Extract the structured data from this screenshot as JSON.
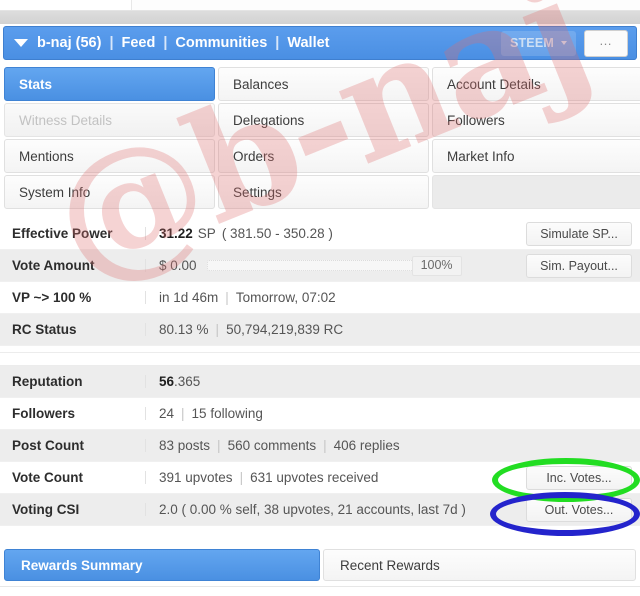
{
  "header": {
    "caret_icon": "chevron-down-icon",
    "account": "b-naj (56)",
    "links": [
      "Feed",
      "Communities",
      "Wallet"
    ],
    "separator": "|",
    "chain_selector": "STEEM",
    "more_button": "…"
  },
  "tabs": [
    {
      "label": "Stats",
      "state": "active"
    },
    {
      "label": "Balances",
      "state": "normal"
    },
    {
      "label": "Account Details",
      "state": "normal"
    },
    {
      "label": "Witness Details",
      "state": "disabled"
    },
    {
      "label": "Delegations",
      "state": "normal"
    },
    {
      "label": "Followers",
      "state": "normal"
    },
    {
      "label": "Mentions",
      "state": "normal"
    },
    {
      "label": "Orders",
      "state": "normal"
    },
    {
      "label": "Market Info",
      "state": "normal"
    },
    {
      "label": "System Info",
      "state": "normal"
    },
    {
      "label": "Settings",
      "state": "normal"
    },
    {
      "label": "",
      "state": "empty"
    }
  ],
  "stats_group_1": [
    {
      "label": "Effective Power",
      "value_main": "31.22",
      "value_unit": "SP",
      "value_detail": "( 381.50 - 350.28 )",
      "action": "Simulate SP..."
    },
    {
      "label": "Vote Amount",
      "value_main": "$ 0.00",
      "bar_percent": "100%",
      "action": "Sim. Payout..."
    },
    {
      "label": "VP ~> 100 %",
      "value_main": "in 1d 46m",
      "value_detail": "Tomorrow, 07:02"
    },
    {
      "label": "RC Status",
      "value_main": "80.13 %",
      "value_detail": "50,794,219,839 RC"
    }
  ],
  "stats_group_2": [
    {
      "label": "Reputation",
      "value_main": "56",
      "value_detail": ".365"
    },
    {
      "label": "Followers",
      "value_main": "24",
      "value_detail": "15 following"
    },
    {
      "label": "Post Count",
      "value_main": "83 posts",
      "value_detail": "560 comments",
      "value_extra": "406 replies"
    },
    {
      "label": "Vote Count",
      "value_main": "391 upvotes",
      "value_detail": "631 upvotes received",
      "action": "Inc. Votes..."
    },
    {
      "label": "Voting CSI",
      "value_main": "2.0 ( 0.00 % self, 38 upvotes, 21 accounts, last 7d )",
      "action": "Out. Votes..."
    }
  ],
  "bottom_tabs": [
    {
      "label": "Rewards Summary",
      "state": "active"
    },
    {
      "label": "Recent Rewards",
      "state": "normal"
    }
  ],
  "watermark": {
    "text": "@b-naj",
    "color": "#de6e6e"
  },
  "annotations": [
    {
      "name": "inc-votes-highlight",
      "shape": "ellipse",
      "color": "#22dd22",
      "target": "Inc. Votes..."
    },
    {
      "name": "out-votes-highlight",
      "shape": "ellipse",
      "color": "#2424cc",
      "target": "Out. Votes..."
    }
  ],
  "colors": {
    "accent_blue": "#4a90e2",
    "header_blue": "#5b9ded",
    "row_alt": "#ededed",
    "green_annotation": "#22dd22",
    "blue_annotation": "#2424cc"
  }
}
